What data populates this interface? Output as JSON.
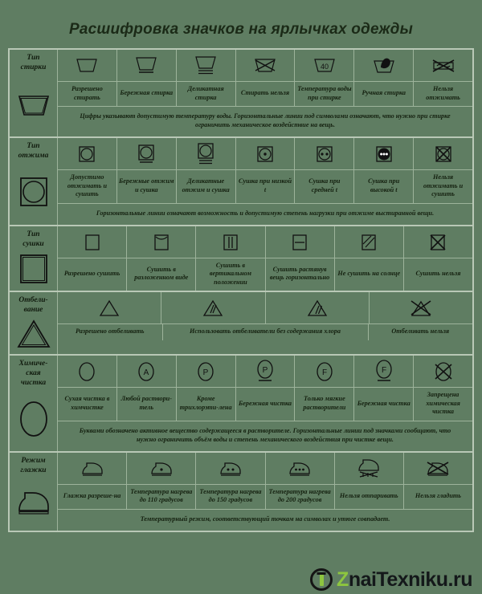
{
  "title": "Расшифровка значков на ярлычках одежды",
  "theme": {
    "background": "#5f7d62",
    "grid_line": "#9db39b",
    "outer_border": "#b9c8b6",
    "text": "#14200f",
    "logo_accent": "#8dc63f"
  },
  "sections": [
    {
      "id": "wash",
      "caption_line1": "Тип",
      "caption_line2": "стирки",
      "big_icon": "wash-basin-icon",
      "icons": [
        "basin-plain-icon",
        "basin-one-bar-icon",
        "basin-two-bars-icon",
        "basin-crossed-icon",
        "basin-temperature-icon",
        "basin-hand-icon",
        "wring-crossed-icon"
      ],
      "labels": [
        {
          "text": "Разрешено стирать",
          "span": 1
        },
        {
          "text": "Бережная стирка",
          "span": 1
        },
        {
          "text": "Деликатная стирка",
          "span": 1
        },
        {
          "text": "Стирать нельзя",
          "span": 1
        },
        {
          "text": "Температура воды при стирке",
          "span": 1
        },
        {
          "text": "Ручная стирка",
          "span": 1
        },
        {
          "text": "Нельзя отжимать",
          "span": 1
        }
      ],
      "note": "Цифры указывают допустимую температуру воды. Горизонтальные линии под символами означают, что нужно при стирке ограничить механическое воздействие на вещь."
    },
    {
      "id": "spin",
      "caption_line1": "Тип",
      "caption_line2": "отжима",
      "big_icon": "tumble-dry-icon",
      "icons": [
        "tumble-plain-icon",
        "tumble-one-bar-icon",
        "tumble-two-bars-icon",
        "tumble-one-dot-icon",
        "tumble-two-dots-icon",
        "tumble-three-dots-icon",
        "tumble-crossed-icon"
      ],
      "labels": [
        {
          "text": "Допустимо отжимать и сушить",
          "span": 1
        },
        {
          "text": "Бережные отжим и сушка",
          "span": 1
        },
        {
          "text": "Деликатные отжим и сушка",
          "span": 1
        },
        {
          "text": "Сушка при низкой t",
          "span": 1
        },
        {
          "text": "Сушка при средней t",
          "span": 1
        },
        {
          "text": "Сушка при высокой t",
          "span": 1
        },
        {
          "text": "Нельзя отжимать и сушить",
          "span": 1
        }
      ],
      "note": "Горизонтальные линии означают возможность и допустимую степень нагрузки при отжиме выстиранной вещи."
    },
    {
      "id": "dry",
      "caption_line1": "Тип",
      "caption_line2": "сушки",
      "big_icon": "square-dry-icon",
      "icons": [
        "square-plain-icon",
        "square-line-top-icon",
        "square-vertical-lines-icon",
        "square-horizontal-line-icon",
        "square-diagonal-icon",
        "square-crossed-icon"
      ],
      "labels": [
        {
          "text": "Разрешено сушить",
          "span": 1
        },
        {
          "text": "Сушить в разложенном виде",
          "span": 1
        },
        {
          "text": "Сушить в вертикальном положении",
          "span": 1
        },
        {
          "text": "Сушить растянув вещь горизонтально",
          "span": 1
        },
        {
          "text": "Не сушить на солнце",
          "span": 1
        },
        {
          "text": "Сушить нельзя",
          "span": 1
        }
      ],
      "note": ""
    },
    {
      "id": "bleach",
      "caption_line1": "Отбели-",
      "caption_line2": "вание",
      "big_icon": "triangle-bleach-icon",
      "icons": [
        "triangle-plain-icon",
        "triangle-double-lines-icon",
        "triangle-two-lines-icon",
        "triangle-crossed-icon"
      ],
      "labels": [
        {
          "text": "Разрешено отбеливать",
          "span": 1
        },
        {
          "text": "Использовать отбеливатели без содержания хлора",
          "span": 2
        },
        {
          "text": "Отбеливать нельзя",
          "span": 1
        }
      ],
      "note": ""
    },
    {
      "id": "dryclean",
      "caption_line1": "Химиче-",
      "caption_line2": "ская",
      "caption_line3": "чистка",
      "big_icon": "circle-dryclean-icon",
      "icons": [
        "circle-plain-icon",
        "circle-a-icon",
        "circle-p-icon",
        "circle-p-bar-icon",
        "circle-f-icon",
        "circle-f-bar-icon",
        "circle-crossed-icon"
      ],
      "labels": [
        {
          "text": "Сухая чистка в химчистке",
          "span": 1
        },
        {
          "text": "Любой раствори-тель",
          "span": 1
        },
        {
          "text": "Кроме трихлорэти-лена",
          "span": 1
        },
        {
          "text": "Бережная чистка",
          "span": 1
        },
        {
          "text": "Только мягкие растворители",
          "span": 1
        },
        {
          "text": "Бережная чистка",
          "span": 1
        },
        {
          "text": "Запрещена химическая чистка",
          "span": 1
        }
      ],
      "note": "Буквами обозначено активное вещество содержащееся в растворителе. Горизонтальные линии под значками сообщают, что нужно ограничить объём воды и степень механического воздействия при чистке вещи."
    },
    {
      "id": "iron",
      "caption_line1": "Режим",
      "caption_line2": "глажки",
      "big_icon": "iron-icon",
      "icons": [
        "iron-plain-icon",
        "iron-one-dot-icon",
        "iron-two-dots-icon",
        "iron-three-dots-icon",
        "iron-no-steam-icon",
        "iron-crossed-icon"
      ],
      "labels": [
        {
          "text": "Глажка разреше-на",
          "span": 1
        },
        {
          "text": "Температура нагрева до 110 градусов",
          "span": 1
        },
        {
          "text": "Температура нагрева до 150 градусов",
          "span": 1
        },
        {
          "text": "Температура нагрева до 200 градусов",
          "span": 1
        },
        {
          "text": "Нельзя отпаривать",
          "span": 1
        },
        {
          "text": "Нельзя гладить",
          "span": 1
        }
      ],
      "note": "Температурный режим, соответствующий точкам на символах и утюге совпадает."
    }
  ],
  "logo": {
    "word_first": "Znai",
    "word_rest": "Texniku.ru",
    "z_letter": "Z",
    "tail": "naiTexniku.ru"
  }
}
